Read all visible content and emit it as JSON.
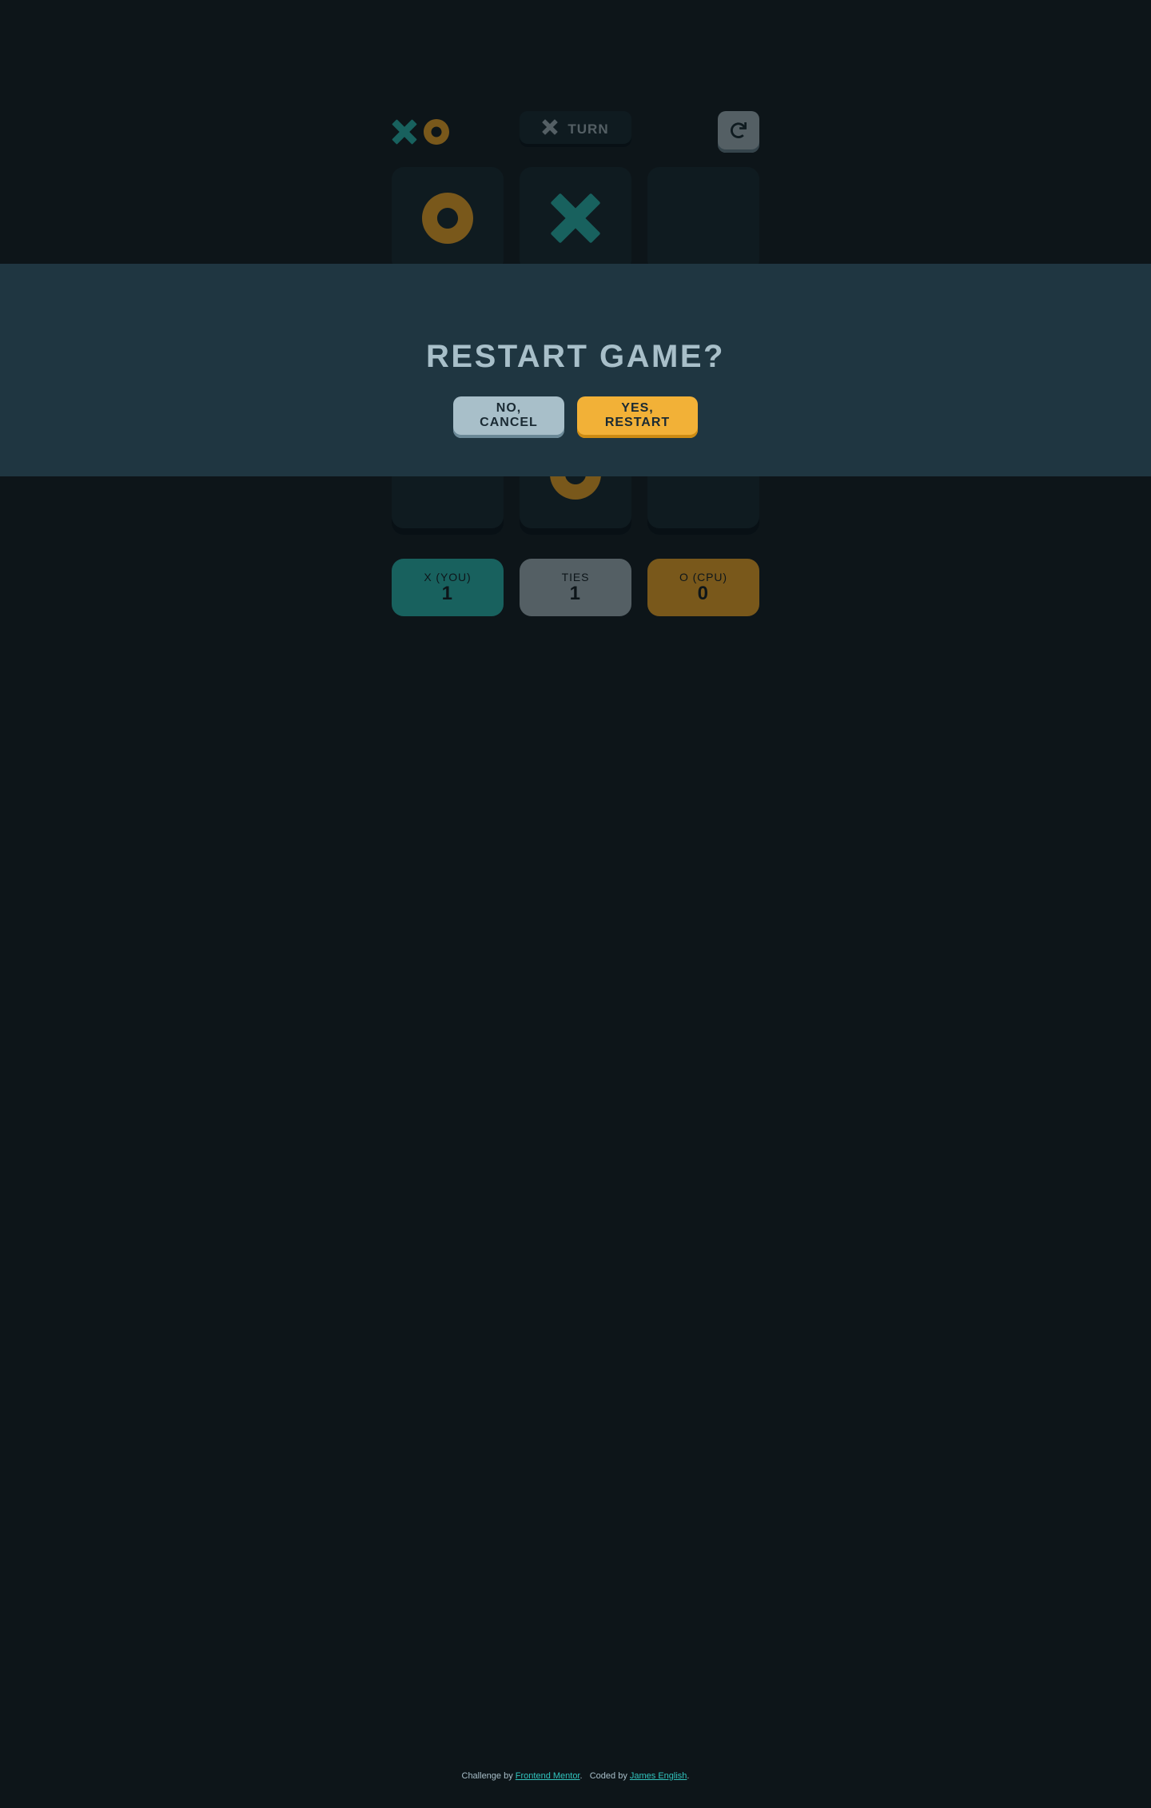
{
  "colors": {
    "background": "#1A2A33",
    "panel": "#1F3641",
    "silver": "#A8BFC9",
    "teal": "#31C3BD",
    "gold": "#F2B137"
  },
  "header": {
    "logo_icons": [
      "x-mark-icon",
      "o-mark-icon"
    ],
    "turn": {
      "mark": "X",
      "label": "TURN"
    },
    "restart_icon": "restart-icon"
  },
  "board": {
    "cells": [
      "O",
      "X",
      "",
      "",
      "",
      "",
      "",
      "O",
      ""
    ]
  },
  "scores": {
    "x": {
      "label": "X (YOU)",
      "value": "1"
    },
    "ties": {
      "label": "TIES",
      "value": "1"
    },
    "o": {
      "label": "O (CPU)",
      "value": "0"
    }
  },
  "modal": {
    "title": "RESTART GAME?",
    "cancel_label": "NO, CANCEL",
    "confirm_label": "YES, RESTART"
  },
  "footer": {
    "prefix": "Challenge by ",
    "challenge_link": "Frontend Mentor",
    "middle": ".   Coded by ",
    "author_link": "James English",
    "suffix": "."
  }
}
